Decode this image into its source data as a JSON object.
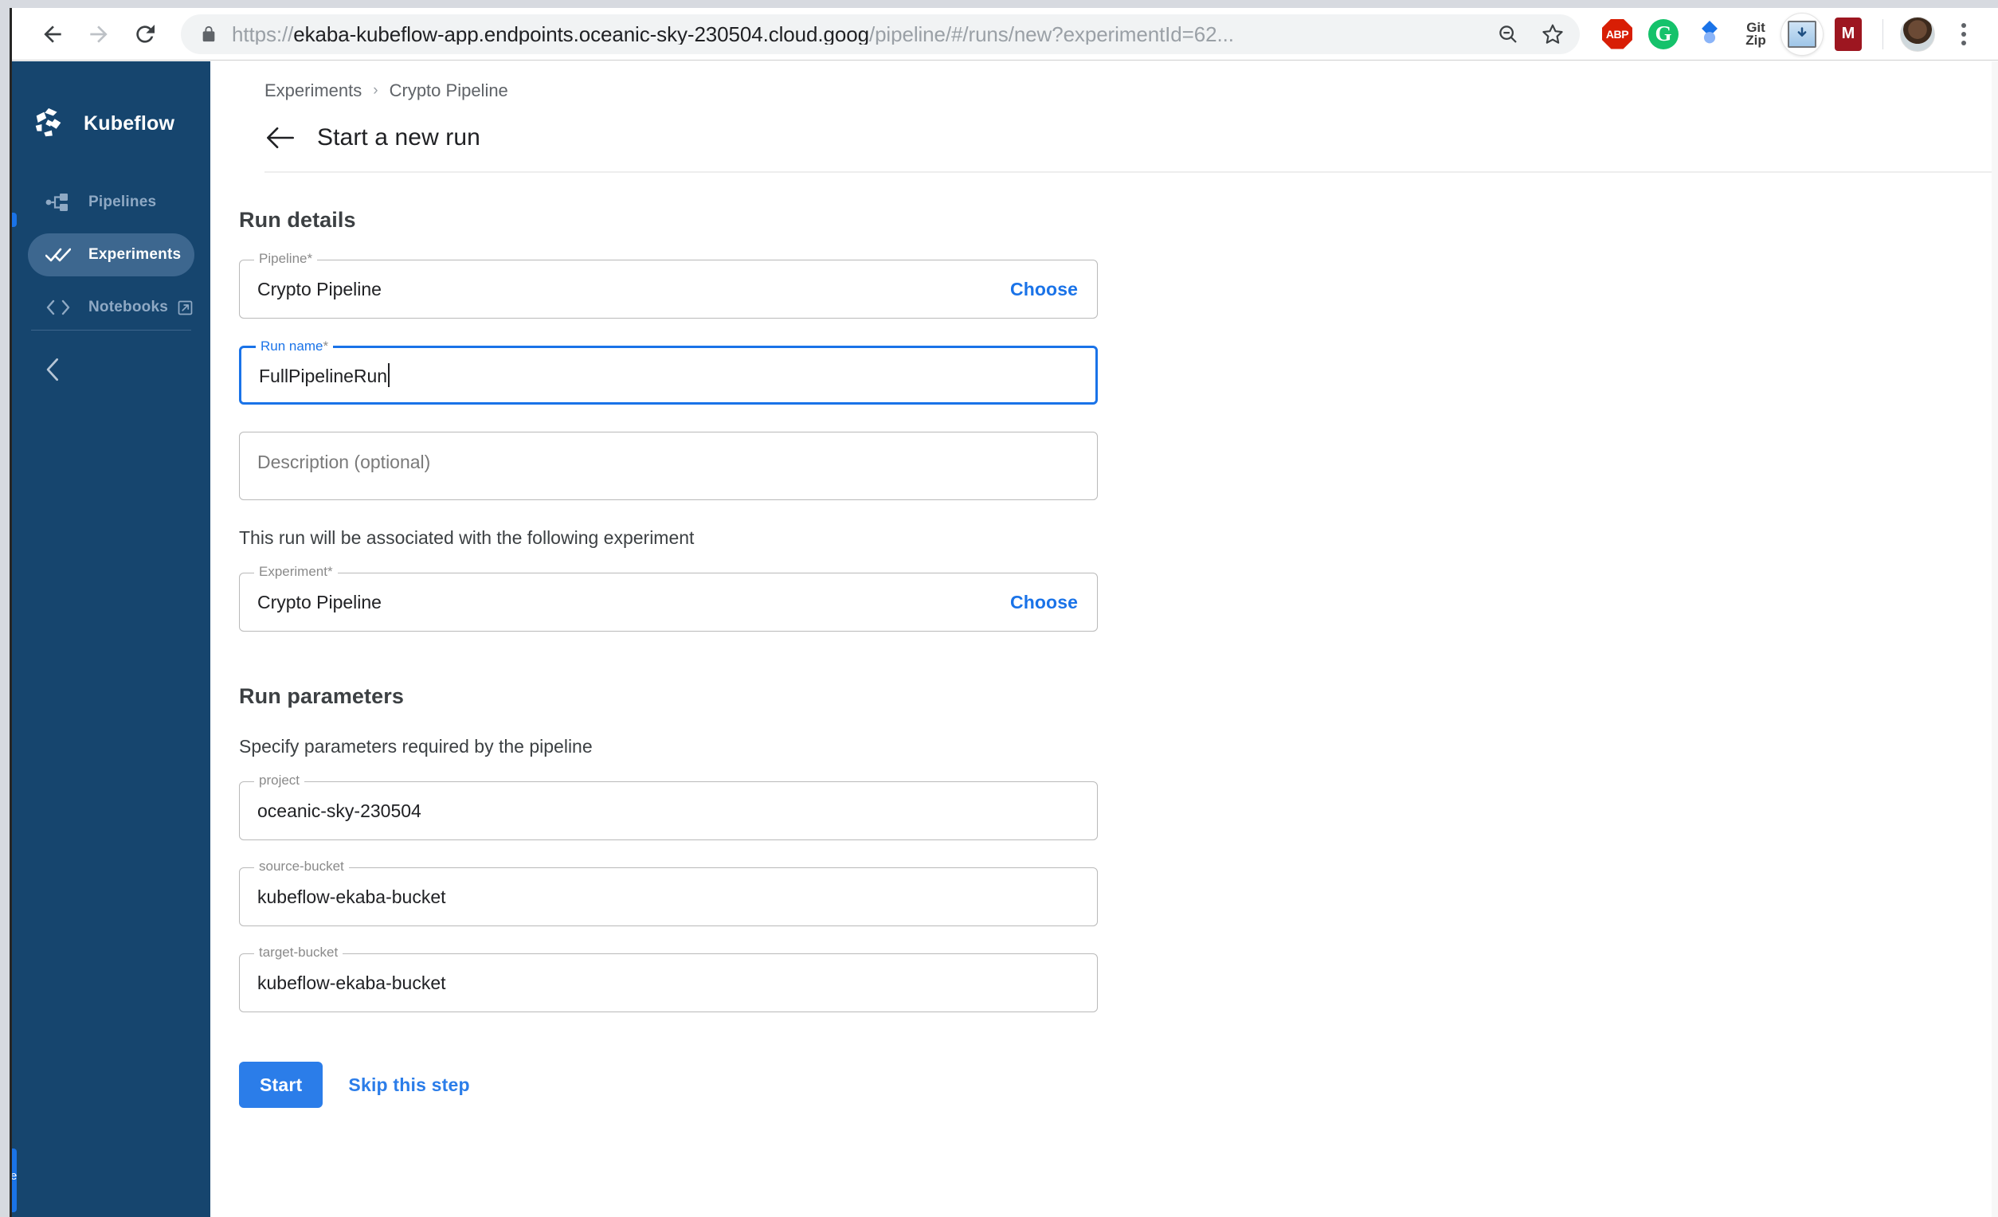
{
  "browser": {
    "url_prefix": "https://",
    "url_host": "ekaba-kubeflow-app.endpoints.oceanic-sky-230504.cloud.goog",
    "url_path": "/pipeline/#/runs/new?experimentId=62...",
    "back_label": "Back",
    "forward_label": "Forward",
    "reload_label": "Reload",
    "lock_icon": "lock-icon",
    "zoom_out_icon": "zoom-out-icon",
    "bookmark_icon": "star-icon",
    "extensions": [
      {
        "name": "adblock-plus",
        "label": "ABP"
      },
      {
        "name": "grammarly",
        "label": "G"
      },
      {
        "name": "diamond-extension",
        "label": ""
      },
      {
        "name": "gitzip",
        "label_top": "Git",
        "label_bottom": "Zip"
      },
      {
        "name": "image-downloader",
        "label": ""
      },
      {
        "name": "mendeley",
        "label": "M"
      }
    ],
    "profile_label": "Profile",
    "menu_icon": "kebab-menu-icon"
  },
  "sidebar": {
    "brand": "Kubeflow",
    "items": [
      {
        "label": "Pipelines",
        "icon": "pipeline-icon",
        "active": false,
        "external": false
      },
      {
        "label": "Experiments",
        "icon": "double-check-icon",
        "active": true,
        "external": false
      },
      {
        "label": "Notebooks",
        "icon": "code-brackets-icon",
        "active": false,
        "external": true
      }
    ],
    "collapse_label": "Collapse",
    "collapse_icon": "chevron-left-icon"
  },
  "header": {
    "breadcrumb": [
      {
        "label": "Experiments"
      },
      {
        "label": "Crypto Pipeline"
      }
    ],
    "breadcrumb_separator": "›",
    "back_icon": "arrow-left-icon",
    "title": "Start a new run"
  },
  "run_details": {
    "section_title": "Run details",
    "pipeline": {
      "legend": "Pipeline",
      "required_mark": "*",
      "value": "Crypto Pipeline",
      "choose_label": "Choose"
    },
    "run_name": {
      "legend": "Run name",
      "required_mark": "*",
      "value": "FullPipelineRun"
    },
    "description": {
      "placeholder": "Description (optional)",
      "value": ""
    },
    "association_note": "This run will be associated with the following experiment",
    "experiment": {
      "legend": "Experiment",
      "required_mark": "*",
      "value": "Crypto Pipeline",
      "choose_label": "Choose"
    }
  },
  "run_parameters": {
    "section_title": "Run parameters",
    "sub_text": "Specify parameters required by the pipeline",
    "fields": [
      {
        "legend": "project",
        "value": "oceanic-sky-230504"
      },
      {
        "legend": "source-bucket",
        "value": "kubeflow-ekaba-bucket"
      },
      {
        "legend": "target-bucket",
        "value": "kubeflow-ekaba-bucket"
      }
    ]
  },
  "actions": {
    "start_label": "Start",
    "skip_label": "Skip this step"
  },
  "colors": {
    "sidebar_bg": "#16456e",
    "sidebar_active": "#3d678f",
    "accent_blue": "#1a73e8",
    "start_blue": "#2b7de9",
    "text_primary": "#202124",
    "text_muted": "#5f6368"
  }
}
